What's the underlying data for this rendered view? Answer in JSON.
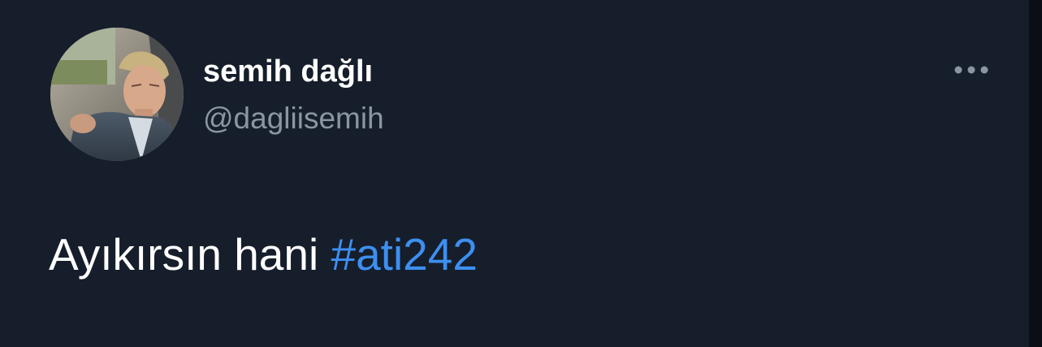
{
  "author": {
    "display_name": "semih dağlı",
    "handle": "@dagliisemih"
  },
  "more_button": {
    "icon": "more-horizontal-icon"
  },
  "tweet": {
    "text_before": "Ayıkırsın hani ",
    "hashtag": "#ati242"
  },
  "colors": {
    "background": "#161e2b",
    "name": "#ffffff",
    "handle": "#8a96a3",
    "hashtag": "#3d8ff0"
  }
}
